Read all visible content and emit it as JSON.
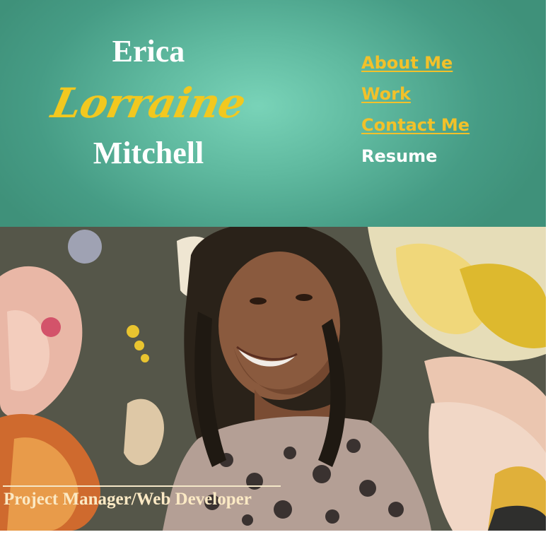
{
  "header": {
    "first_name": "Erica",
    "middle_name": "Lorraine",
    "last_name": "Mitchell"
  },
  "nav": {
    "items": [
      {
        "label": "About Me",
        "active": false
      },
      {
        "label": "Work",
        "active": false
      },
      {
        "label": "Contact Me",
        "active": false
      },
      {
        "label": "Resume",
        "active": true
      }
    ]
  },
  "hero": {
    "caption": "Project Manager/Web Developer"
  },
  "colors": {
    "header_teal": "#5fb99f",
    "accent_yellow": "#f2c12a",
    "text_white": "#ffffff",
    "caption_cream": "#fbe9c4"
  }
}
